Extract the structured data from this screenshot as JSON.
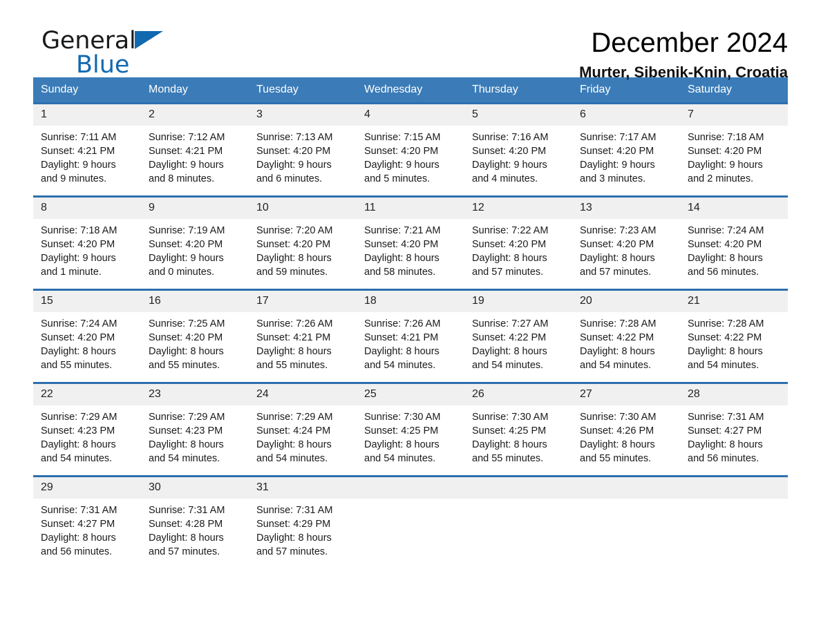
{
  "brand": {
    "word1": "General",
    "word2": "Blue",
    "triangle_color": "#1169b0",
    "logo_icon": "triangle-icon"
  },
  "header": {
    "title": "December 2024",
    "subtitle": "Murter, Sibenik-Knin, Croatia"
  },
  "theme": {
    "header_blue": "#3b7cb8",
    "row_rule_blue": "#2c6fae",
    "daynum_band": "#f0f0f0"
  },
  "weekday_headers": [
    "Sunday",
    "Monday",
    "Tuesday",
    "Wednesday",
    "Thursday",
    "Friday",
    "Saturday"
  ],
  "weeks": [
    [
      {
        "day": "1",
        "sunrise": "Sunrise: 7:11 AM",
        "sunset": "Sunset: 4:21 PM",
        "daylight1": "Daylight: 9 hours",
        "daylight2": "and 9 minutes."
      },
      {
        "day": "2",
        "sunrise": "Sunrise: 7:12 AM",
        "sunset": "Sunset: 4:21 PM",
        "daylight1": "Daylight: 9 hours",
        "daylight2": "and 8 minutes."
      },
      {
        "day": "3",
        "sunrise": "Sunrise: 7:13 AM",
        "sunset": "Sunset: 4:20 PM",
        "daylight1": "Daylight: 9 hours",
        "daylight2": "and 6 minutes."
      },
      {
        "day": "4",
        "sunrise": "Sunrise: 7:15 AM",
        "sunset": "Sunset: 4:20 PM",
        "daylight1": "Daylight: 9 hours",
        "daylight2": "and 5 minutes."
      },
      {
        "day": "5",
        "sunrise": "Sunrise: 7:16 AM",
        "sunset": "Sunset: 4:20 PM",
        "daylight1": "Daylight: 9 hours",
        "daylight2": "and 4 minutes."
      },
      {
        "day": "6",
        "sunrise": "Sunrise: 7:17 AM",
        "sunset": "Sunset: 4:20 PM",
        "daylight1": "Daylight: 9 hours",
        "daylight2": "and 3 minutes."
      },
      {
        "day": "7",
        "sunrise": "Sunrise: 7:18 AM",
        "sunset": "Sunset: 4:20 PM",
        "daylight1": "Daylight: 9 hours",
        "daylight2": "and 2 minutes."
      }
    ],
    [
      {
        "day": "8",
        "sunrise": "Sunrise: 7:18 AM",
        "sunset": "Sunset: 4:20 PM",
        "daylight1": "Daylight: 9 hours",
        "daylight2": "and 1 minute."
      },
      {
        "day": "9",
        "sunrise": "Sunrise: 7:19 AM",
        "sunset": "Sunset: 4:20 PM",
        "daylight1": "Daylight: 9 hours",
        "daylight2": "and 0 minutes."
      },
      {
        "day": "10",
        "sunrise": "Sunrise: 7:20 AM",
        "sunset": "Sunset: 4:20 PM",
        "daylight1": "Daylight: 8 hours",
        "daylight2": "and 59 minutes."
      },
      {
        "day": "11",
        "sunrise": "Sunrise: 7:21 AM",
        "sunset": "Sunset: 4:20 PM",
        "daylight1": "Daylight: 8 hours",
        "daylight2": "and 58 minutes."
      },
      {
        "day": "12",
        "sunrise": "Sunrise: 7:22 AM",
        "sunset": "Sunset: 4:20 PM",
        "daylight1": "Daylight: 8 hours",
        "daylight2": "and 57 minutes."
      },
      {
        "day": "13",
        "sunrise": "Sunrise: 7:23 AM",
        "sunset": "Sunset: 4:20 PM",
        "daylight1": "Daylight: 8 hours",
        "daylight2": "and 57 minutes."
      },
      {
        "day": "14",
        "sunrise": "Sunrise: 7:24 AM",
        "sunset": "Sunset: 4:20 PM",
        "daylight1": "Daylight: 8 hours",
        "daylight2": "and 56 minutes."
      }
    ],
    [
      {
        "day": "15",
        "sunrise": "Sunrise: 7:24 AM",
        "sunset": "Sunset: 4:20 PM",
        "daylight1": "Daylight: 8 hours",
        "daylight2": "and 55 minutes."
      },
      {
        "day": "16",
        "sunrise": "Sunrise: 7:25 AM",
        "sunset": "Sunset: 4:20 PM",
        "daylight1": "Daylight: 8 hours",
        "daylight2": "and 55 minutes."
      },
      {
        "day": "17",
        "sunrise": "Sunrise: 7:26 AM",
        "sunset": "Sunset: 4:21 PM",
        "daylight1": "Daylight: 8 hours",
        "daylight2": "and 55 minutes."
      },
      {
        "day": "18",
        "sunrise": "Sunrise: 7:26 AM",
        "sunset": "Sunset: 4:21 PM",
        "daylight1": "Daylight: 8 hours",
        "daylight2": "and 54 minutes."
      },
      {
        "day": "19",
        "sunrise": "Sunrise: 7:27 AM",
        "sunset": "Sunset: 4:22 PM",
        "daylight1": "Daylight: 8 hours",
        "daylight2": "and 54 minutes."
      },
      {
        "day": "20",
        "sunrise": "Sunrise: 7:28 AM",
        "sunset": "Sunset: 4:22 PM",
        "daylight1": "Daylight: 8 hours",
        "daylight2": "and 54 minutes."
      },
      {
        "day": "21",
        "sunrise": "Sunrise: 7:28 AM",
        "sunset": "Sunset: 4:22 PM",
        "daylight1": "Daylight: 8 hours",
        "daylight2": "and 54 minutes."
      }
    ],
    [
      {
        "day": "22",
        "sunrise": "Sunrise: 7:29 AM",
        "sunset": "Sunset: 4:23 PM",
        "daylight1": "Daylight: 8 hours",
        "daylight2": "and 54 minutes."
      },
      {
        "day": "23",
        "sunrise": "Sunrise: 7:29 AM",
        "sunset": "Sunset: 4:23 PM",
        "daylight1": "Daylight: 8 hours",
        "daylight2": "and 54 minutes."
      },
      {
        "day": "24",
        "sunrise": "Sunrise: 7:29 AM",
        "sunset": "Sunset: 4:24 PM",
        "daylight1": "Daylight: 8 hours",
        "daylight2": "and 54 minutes."
      },
      {
        "day": "25",
        "sunrise": "Sunrise: 7:30 AM",
        "sunset": "Sunset: 4:25 PM",
        "daylight1": "Daylight: 8 hours",
        "daylight2": "and 54 minutes."
      },
      {
        "day": "26",
        "sunrise": "Sunrise: 7:30 AM",
        "sunset": "Sunset: 4:25 PM",
        "daylight1": "Daylight: 8 hours",
        "daylight2": "and 55 minutes."
      },
      {
        "day": "27",
        "sunrise": "Sunrise: 7:30 AM",
        "sunset": "Sunset: 4:26 PM",
        "daylight1": "Daylight: 8 hours",
        "daylight2": "and 55 minutes."
      },
      {
        "day": "28",
        "sunrise": "Sunrise: 7:31 AM",
        "sunset": "Sunset: 4:27 PM",
        "daylight1": "Daylight: 8 hours",
        "daylight2": "and 56 minutes."
      }
    ],
    [
      {
        "day": "29",
        "sunrise": "Sunrise: 7:31 AM",
        "sunset": "Sunset: 4:27 PM",
        "daylight1": "Daylight: 8 hours",
        "daylight2": "and 56 minutes."
      },
      {
        "day": "30",
        "sunrise": "Sunrise: 7:31 AM",
        "sunset": "Sunset: 4:28 PM",
        "daylight1": "Daylight: 8 hours",
        "daylight2": "and 57 minutes."
      },
      {
        "day": "31",
        "sunrise": "Sunrise: 7:31 AM",
        "sunset": "Sunset: 4:29 PM",
        "daylight1": "Daylight: 8 hours",
        "daylight2": "and 57 minutes."
      },
      {
        "day": "",
        "sunrise": "",
        "sunset": "",
        "daylight1": "",
        "daylight2": ""
      },
      {
        "day": "",
        "sunrise": "",
        "sunset": "",
        "daylight1": "",
        "daylight2": ""
      },
      {
        "day": "",
        "sunrise": "",
        "sunset": "",
        "daylight1": "",
        "daylight2": ""
      },
      {
        "day": "",
        "sunrise": "",
        "sunset": "",
        "daylight1": "",
        "daylight2": ""
      }
    ]
  ]
}
